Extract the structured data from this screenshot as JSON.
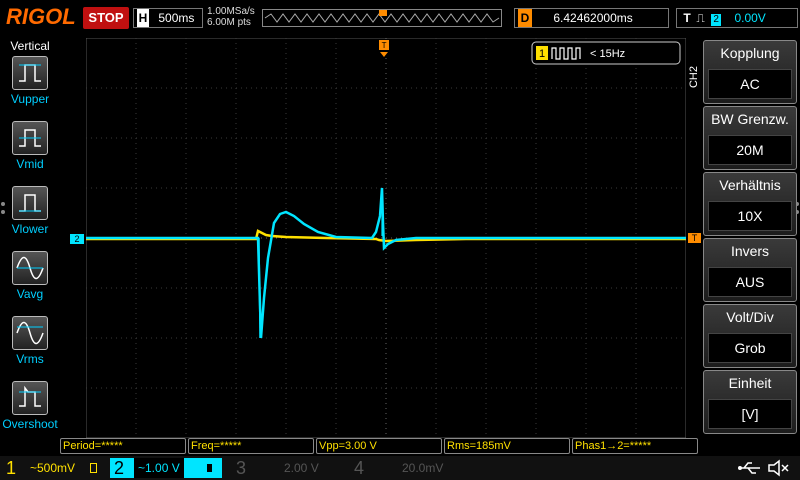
{
  "brand": "RIGOL",
  "run_state": "STOP",
  "timebase": {
    "letter": "H",
    "value": "500ms"
  },
  "sample": {
    "rate": "1.00MSa/s",
    "points": "6.00M pts"
  },
  "delay": {
    "letter": "D",
    "value": "6.42462000ms"
  },
  "trigger": {
    "letter": "T",
    "symbol": "⎍",
    "source": "2",
    "level": "0.00V"
  },
  "left_menu": {
    "title": "Vertical",
    "items": [
      {
        "label": "Vupper"
      },
      {
        "label": "Vmid"
      },
      {
        "label": "Vlower"
      },
      {
        "label": "Vavg"
      },
      {
        "label": "Vrms"
      },
      {
        "label": "Overshoot"
      }
    ]
  },
  "right_menu": {
    "tab": "CH2",
    "items": [
      {
        "header": "Kopplung",
        "value": "AC",
        "arrow": true
      },
      {
        "header": "BW Grenzw.",
        "value": "20M",
        "arrow": false
      },
      {
        "header": "Verhältnis",
        "value": "10X",
        "arrow": true
      },
      {
        "header": "Invers",
        "value": "AUS",
        "arrow": false
      },
      {
        "header": "Volt/Div",
        "value": "Grob",
        "arrow": false
      },
      {
        "header": "Einheit",
        "value": "[V]",
        "arrow": true
      }
    ]
  },
  "freq_counter": {
    "channel": "1",
    "text": "< 15Hz"
  },
  "markers": {
    "ch2": "2",
    "trig": "T",
    "trig_pos": "T"
  },
  "measurements": [
    {
      "text": "Period=*****"
    },
    {
      "text": "Freq=*****"
    },
    {
      "text": "Vpp=3.00 V"
    },
    {
      "text": "Rms=185mV"
    },
    {
      "text": "Phas1→2=*****"
    }
  ],
  "channels": [
    {
      "num": "1",
      "scale": "~500mV",
      "color": "#ffe000",
      "active": true
    },
    {
      "num": "2",
      "scale": "~1.00 V",
      "color": "#00e5ff",
      "active": true
    },
    {
      "num": "3",
      "scale": "2.00 V",
      "color": "#555555",
      "active": false
    },
    {
      "num": "4",
      "scale": "20.0mV",
      "color": "#555555",
      "active": false
    }
  ],
  "colors": {
    "ch1": "#ffe000",
    "ch2": "#00e5ff",
    "trigger": "#ff8c00",
    "accent": "#00cfff"
  }
}
